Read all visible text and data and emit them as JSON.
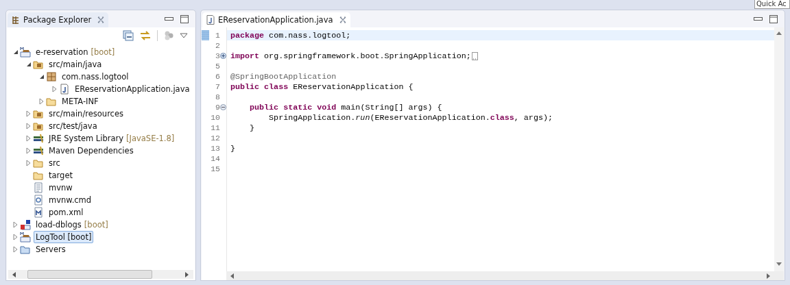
{
  "quick_access": {
    "placeholder": "Quick Ac"
  },
  "explorer": {
    "title": "Package Explorer",
    "tree": [
      {
        "label": "e-reservation",
        "decoration": "[boot]",
        "kind": "project",
        "expanded": true,
        "selected": false,
        "children": [
          {
            "label": "src/main/java",
            "kind": "source-folder",
            "expanded": true,
            "selected": false,
            "children": [
              {
                "label": "com.nass.logtool",
                "kind": "package",
                "expanded": true,
                "selected": false,
                "children": [
                  {
                    "label": "EReservationApplication.java",
                    "kind": "java-file",
                    "expanded": false,
                    "selected": false
                  }
                ]
              },
              {
                "label": "META-INF",
                "kind": "folder",
                "expanded": false,
                "selected": false
              }
            ]
          },
          {
            "label": "src/main/resources",
            "kind": "source-folder",
            "expanded": false,
            "selected": false
          },
          {
            "label": "src/test/java",
            "kind": "source-folder",
            "expanded": false,
            "selected": false
          },
          {
            "label": "JRE System Library",
            "decoration": "[JavaSE-1.8]",
            "kind": "library",
            "expanded": false,
            "selected": false
          },
          {
            "label": "Maven Dependencies",
            "kind": "library",
            "expanded": false,
            "selected": false
          },
          {
            "label": "src",
            "kind": "folder",
            "expanded": false,
            "selected": false
          },
          {
            "label": "target",
            "kind": "folder",
            "selected": false
          },
          {
            "label": "mvnw",
            "kind": "text-file",
            "selected": false
          },
          {
            "label": "mvnw.cmd",
            "kind": "cmd-file",
            "selected": false
          },
          {
            "label": "pom.xml",
            "kind": "pom-file",
            "selected": false
          }
        ]
      },
      {
        "label": "load-dblogs",
        "decoration": "[boot]",
        "kind": "error-project",
        "expanded": false,
        "selected": false
      },
      {
        "label": "LogTool [boot]",
        "kind": "project",
        "expanded": false,
        "selected": true
      },
      {
        "label": "Servers",
        "kind": "open-folder",
        "expanded": false,
        "selected": false
      }
    ]
  },
  "editor": {
    "tab": "EReservationApplication.java",
    "lines": [
      {
        "number": "1",
        "current": true,
        "tokens": [
          {
            "kind": "keyword",
            "text": "package"
          },
          {
            "kind": "plain",
            "text": " com.nass.logtool;"
          }
        ]
      },
      {
        "number": "2",
        "current": false
      },
      {
        "number": "3",
        "current": false,
        "folded": true,
        "tokens": [
          {
            "kind": "keyword",
            "text": "import"
          },
          {
            "kind": "plain",
            "text": " org.springframework.boot.SpringApplication;"
          }
        ]
      },
      {
        "number": "5",
        "current": false
      },
      {
        "number": "6",
        "current": false,
        "tokens": [
          {
            "kind": "annotation",
            "text": "@SpringBootApplication"
          }
        ]
      },
      {
        "number": "7",
        "current": false,
        "tokens": [
          {
            "kind": "keyword",
            "text": "public class"
          },
          {
            "kind": "plain",
            "text": " EReservationApplication {"
          }
        ]
      },
      {
        "number": "8",
        "current": false
      },
      {
        "number": "9",
        "current": false,
        "folded": false,
        "tokens": [
          {
            "kind": "keyword",
            "text": "    public static void"
          },
          {
            "kind": "plain",
            "text": " main(String[] args) {"
          }
        ]
      },
      {
        "number": "10",
        "current": false,
        "tokens": [
          {
            "kind": "plain",
            "text": "        SpringApplication."
          },
          {
            "kind": "static_method",
            "text": "run"
          },
          {
            "kind": "plain",
            "text": "(EReservationApplication."
          },
          {
            "kind": "keyword",
            "text": "class"
          },
          {
            "kind": "plain",
            "text": ", args);"
          }
        ]
      },
      {
        "number": "11",
        "current": false,
        "tokens": [
          {
            "kind": "plain",
            "text": "    }"
          }
        ]
      },
      {
        "number": "12",
        "current": false
      },
      {
        "number": "13",
        "current": false,
        "tokens": [
          {
            "kind": "plain",
            "text": "}"
          }
        ]
      },
      {
        "number": "14",
        "current": false
      },
      {
        "number": "15",
        "current": false
      }
    ]
  }
}
